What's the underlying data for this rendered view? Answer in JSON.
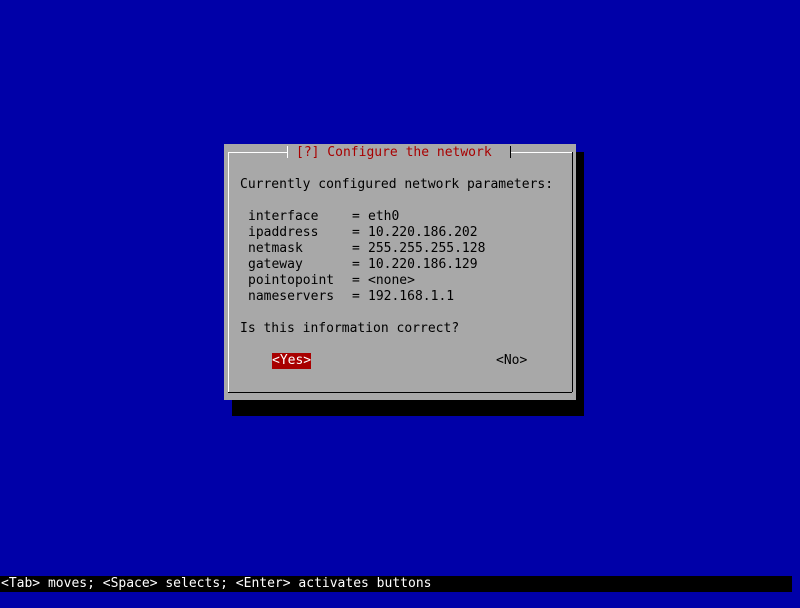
{
  "colors": {
    "background": "#0000a8",
    "dialog": "#a8a8a8",
    "title": "#a80000",
    "selected_button_bg": "#a80000",
    "statusbar_bg": "#000000"
  },
  "dialog": {
    "title": "[?] Configure the network",
    "prompt": "Currently configured network parameters:",
    "params": [
      {
        "key": "interface",
        "value": "eth0"
      },
      {
        "key": "ipaddress",
        "value": "10.220.186.202"
      },
      {
        "key": "netmask",
        "value": "255.255.255.128"
      },
      {
        "key": "gateway",
        "value": "10.220.186.129"
      },
      {
        "key": "pointopoint",
        "value": "<none>"
      },
      {
        "key": "nameservers",
        "value": "192.168.1.1"
      }
    ],
    "equals": "=",
    "question": "Is this information correct?",
    "buttons": {
      "yes": "<Yes>",
      "no": "<No>"
    }
  },
  "statusbar": {
    "text": "<Tab> moves; <Space> selects; <Enter> activates buttons"
  }
}
